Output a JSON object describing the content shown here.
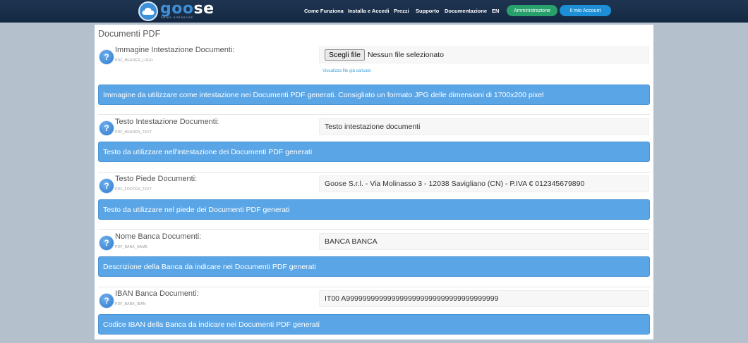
{
  "brand": {
    "logo_part1": "goo",
    "logo_part2": "se",
    "tagline": "sales enhanced"
  },
  "nav": {
    "links": [
      "Come Funziona",
      "Installa e Accedi",
      "Prezzi",
      "Supporto",
      "Documentazione",
      "EN"
    ],
    "admin_button": "Amministrazione",
    "account_button": "Il mio Account"
  },
  "section": {
    "title": "Documenti PDF"
  },
  "fields": [
    {
      "label": "Immagine Intestazione Documenti:",
      "key": "PDF_HEADER_LOGO",
      "file_button": "Scegli file",
      "file_status": "Nessun file selezionato",
      "view_link": "Visualizza file già caricato",
      "help": "Immagine da utilizzare come intestazione nei Documenti PDF generati. Consigliato un formato JPG delle dimensioni di 1700x200 pixel"
    },
    {
      "label": "Testo Intestazione Documenti:",
      "key": "PDF_HEADER_TEXT",
      "value": "Testo intestazione documenti",
      "help": "Testo da utilizzare nell'intestazione dei Documenti PDF generati"
    },
    {
      "label": "Testo Piede Documenti:",
      "key": "PDF_FOOTER_TEXT",
      "value": "Goose S.r.l. - Via Molinasso 3 - 12038 Savigliano (CN) - P.IVA € 012345679890",
      "help": "Testo da utilizzare nel piede dei Documenti PDF generati"
    },
    {
      "label": "Nome Banca Documenti:",
      "key": "PDF_BANK_NAME",
      "value": "BANCA BANCA",
      "help": "Descrizione della Banca da indicare nei Documenti PDF generati"
    },
    {
      "label": "IBAN Banca Documenti:",
      "key": "PDF_BANK_IBAN",
      "value": "IT00 A9999999999999999999999999999999999999",
      "help": "Codice IBAN della Banca da indicare nei Documenti PDF generati"
    }
  ],
  "icons": {
    "help": "question-circle-icon",
    "logo": "cloud-logo-icon"
  },
  "colors": {
    "navbar": "#1e3551",
    "accent": "#5aa5e6",
    "admin": "#28a06b",
    "account": "#1c8fd6"
  }
}
